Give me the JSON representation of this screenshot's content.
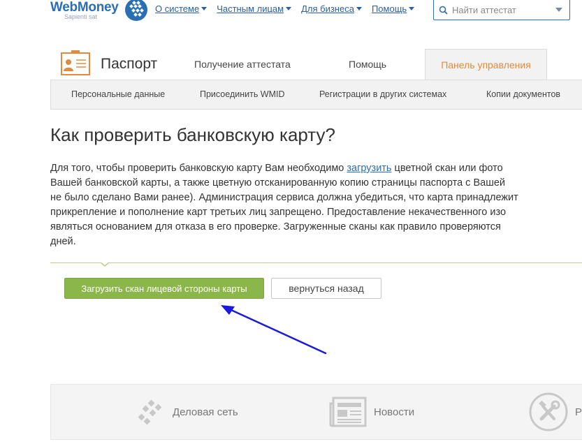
{
  "header": {
    "logo_text": "WebMoney",
    "logo_tagline": "Sapienti sat",
    "nav": [
      {
        "label": "О системе"
      },
      {
        "label": "Частным лицам"
      },
      {
        "label": "Для бизнеса"
      },
      {
        "label": "Помощь"
      }
    ],
    "search_placeholder": "Найти аттестат"
  },
  "passport": {
    "title": "Паспорт",
    "tabs": [
      {
        "label": "Получение аттестата"
      },
      {
        "label": "Помощь"
      },
      {
        "label": "Панель управления",
        "active": true
      }
    ],
    "subnav": [
      {
        "label": "Персональные данные"
      },
      {
        "label": "Присоединить WMID"
      },
      {
        "label": "Регистрации в других системах"
      },
      {
        "label": "Копии документов"
      }
    ]
  },
  "content": {
    "title": "Как проверить банковскую карту?",
    "para_line1_a": "Для того, чтобы проверить банковскую карту Вам необходимо ",
    "para_link": "загрузить",
    "para_line1_b": " цветной скан или фото",
    "para_lines": [
      "Вашей банковской карты, а также цветную отсканированную копию страницы паспорта с Вашей",
      "не было сделано Вами ранее). Администрация сервиса должна убедиться, что карта принадлежит",
      "прикрепление и пополнение карт третьих лиц запрещено. Предоставление некачественного изо",
      "являться основанием для отказа в его проверке. Загруженные сканы как правило проверяются",
      "дней."
    ],
    "upload_button": "Загрузить скан лицевой стороны карты",
    "back_button": "вернуться назад"
  },
  "footer": {
    "items": [
      {
        "label": "Деловая сеть"
      },
      {
        "label": "Новости"
      },
      {
        "label": "Ра"
      }
    ]
  },
  "colors": {
    "brand_blue": "#2a6fb4",
    "accent_orange": "#e28a3c",
    "button_green": "#8bb64a",
    "annotation_arrow": "#1a1adf"
  }
}
